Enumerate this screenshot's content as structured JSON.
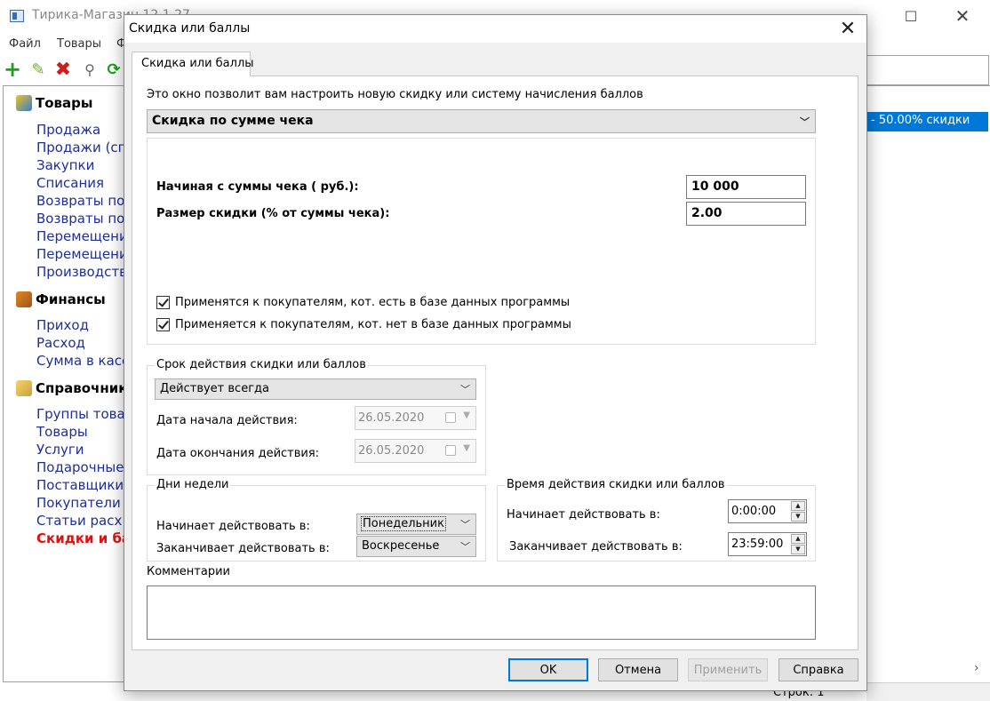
{
  "main_window": {
    "title": "Тирика-Магазин 12.1.27",
    "menu": [
      "Файл",
      "Товары",
      "Ф"
    ],
    "sections": [
      {
        "title": "Товары",
        "links": [
          "Продажа",
          "Продажи (сп",
          "Закупки",
          "Списания",
          "Возвраты по",
          "Возвраты по",
          "Перемещени",
          "Перемещени",
          "Производств"
        ]
      },
      {
        "title": "Финансы",
        "links": [
          "Приход",
          "Расход",
          "Сумма в касс"
        ]
      },
      {
        "title": "Справочник",
        "links": [
          "Группы това",
          "Товары",
          "Услуги",
          "Подарочные",
          "Поставщики",
          "Покупатели",
          "Статьи расх",
          "Скидки и ба"
        ]
      }
    ],
    "selected_row": "- 50.00% скидки",
    "status": "Строк: 1"
  },
  "dialog": {
    "title": "Скидка или баллы",
    "tab": "Скидка или баллы",
    "intro": "Это окно позволит вам настроить новую скидку или систему начисления баллов",
    "discount_type": "Скидка по сумме чека",
    "from_sum_label": "Начиная с суммы чека ( руб.):",
    "from_sum_value": "10 000",
    "discount_size_label": "Размер скидки (% от суммы чека):",
    "discount_size_value": "2.00",
    "check_existing": "Применятся к покупателям, кот. есть в базе данных программы",
    "check_new": "Применяется к покупателям, кот. нет в базе данных программы",
    "period": {
      "title": "Срок действия скидки или баллов",
      "mode": "Действует всегда",
      "start_label": "Дата начала действия:",
      "start_value": "26.05.2020",
      "end_label": "Дата окончания действия:",
      "end_value": "26.05.2020"
    },
    "weekdays": {
      "title": "Дни недели",
      "start_label": "Начинает действовать в:",
      "start_value": "Понедельник",
      "end_label": "Заканчивает действовать в:",
      "end_value": "Воскресенье"
    },
    "time": {
      "title": "Время действия скидки или баллов",
      "start_label": "Начинает действовать в:",
      "start_value": "0:00:00",
      "end_label": "Заканчивает действовать в:",
      "end_value": "23:59:00"
    },
    "comments_label": "Комментарии",
    "buttons": {
      "ok": "OK",
      "cancel": "Отмена",
      "apply": "Применить",
      "help": "Справка"
    }
  }
}
